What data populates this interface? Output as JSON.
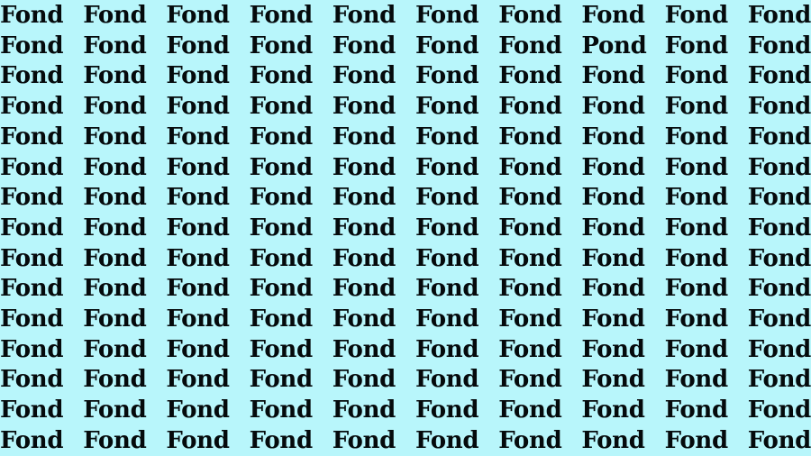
{
  "puzzle": {
    "type": "find-the-odd-word",
    "background_color": "#b8f6fb",
    "text_color": "#050a0c",
    "rows": 15,
    "columns": 10,
    "repeated_word": "Fond",
    "odd_word": "Pond",
    "odd_position": {
      "row": 2,
      "column": 8
    },
    "grid": [
      [
        "Fond",
        "Fond",
        "Fond",
        "Fond",
        "Fond",
        "Fond",
        "Fond",
        "Fond",
        "Fond",
        "Fond"
      ],
      [
        "Fond",
        "Fond",
        "Fond",
        "Fond",
        "Fond",
        "Fond",
        "Fond",
        "Pond",
        "Fond",
        "Fond"
      ],
      [
        "Fond",
        "Fond",
        "Fond",
        "Fond",
        "Fond",
        "Fond",
        "Fond",
        "Fond",
        "Fond",
        "Fond"
      ],
      [
        "Fond",
        "Fond",
        "Fond",
        "Fond",
        "Fond",
        "Fond",
        "Fond",
        "Fond",
        "Fond",
        "Fond"
      ],
      [
        "Fond",
        "Fond",
        "Fond",
        "Fond",
        "Fond",
        "Fond",
        "Fond",
        "Fond",
        "Fond",
        "Fond"
      ],
      [
        "Fond",
        "Fond",
        "Fond",
        "Fond",
        "Fond",
        "Fond",
        "Fond",
        "Fond",
        "Fond",
        "Fond"
      ],
      [
        "Fond",
        "Fond",
        "Fond",
        "Fond",
        "Fond",
        "Fond",
        "Fond",
        "Fond",
        "Fond",
        "Fond"
      ],
      [
        "Fond",
        "Fond",
        "Fond",
        "Fond",
        "Fond",
        "Fond",
        "Fond",
        "Fond",
        "Fond",
        "Fond"
      ],
      [
        "Fond",
        "Fond",
        "Fond",
        "Fond",
        "Fond",
        "Fond",
        "Fond",
        "Fond",
        "Fond",
        "Fond"
      ],
      [
        "Fond",
        "Fond",
        "Fond",
        "Fond",
        "Fond",
        "Fond",
        "Fond",
        "Fond",
        "Fond",
        "Fond"
      ],
      [
        "Fond",
        "Fond",
        "Fond",
        "Fond",
        "Fond",
        "Fond",
        "Fond",
        "Fond",
        "Fond",
        "Fond"
      ],
      [
        "Fond",
        "Fond",
        "Fond",
        "Fond",
        "Fond",
        "Fond",
        "Fond",
        "Fond",
        "Fond",
        "Fond"
      ],
      [
        "Fond",
        "Fond",
        "Fond",
        "Fond",
        "Fond",
        "Fond",
        "Fond",
        "Fond",
        "Fond",
        "Fond"
      ],
      [
        "Fond",
        "Fond",
        "Fond",
        "Fond",
        "Fond",
        "Fond",
        "Fond",
        "Fond",
        "Fond",
        "Fond"
      ],
      [
        "Fond",
        "Fond",
        "Fond",
        "Fond",
        "Fond",
        "Fond",
        "Fond",
        "Fond",
        "Fond",
        "Fond"
      ]
    ]
  }
}
